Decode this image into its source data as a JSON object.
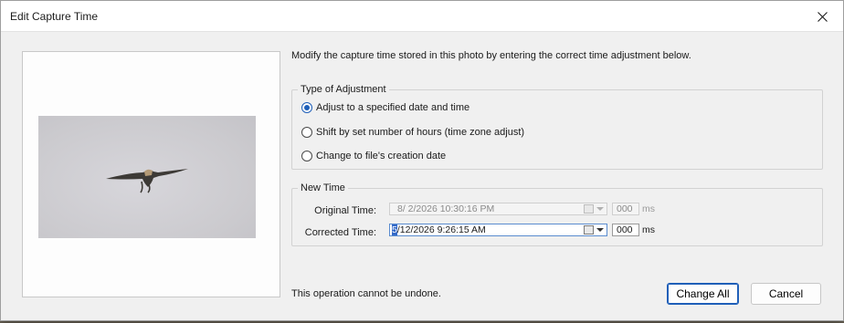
{
  "dialog": {
    "title": "Edit Capture Time",
    "instruction": "Modify the capture time stored in this photo by entering the correct time adjustment below.",
    "warning": "This operation cannot be undone."
  },
  "adjustment": {
    "legend": "Type of Adjustment",
    "options": [
      {
        "label": "Adjust to a specified date and time",
        "checked": true
      },
      {
        "label": "Shift by set number of hours (time zone adjust)",
        "checked": false
      },
      {
        "label": "Change to file's creation date",
        "checked": false
      }
    ]
  },
  "new_time": {
    "legend": "New Time",
    "original_label": "Original Time:",
    "original_value": "8/  2/2026 10:30:16 PM",
    "original_ms": "000",
    "corrected_label": "Corrected Time:",
    "corrected_selected": "5",
    "corrected_rest": "/12/2026   9:26:15 AM",
    "corrected_ms": "000",
    "ms_unit": "ms"
  },
  "buttons": {
    "change_all": "Change All",
    "cancel": "Cancel"
  },
  "colors": {
    "accent": "#1f5fb8",
    "selection": "#3369c8",
    "dialog_bg": "#f0f0f0"
  },
  "icons": {
    "close": "close-icon",
    "calendar": "calendar-icon",
    "dropdown": "chevron-down-icon"
  }
}
